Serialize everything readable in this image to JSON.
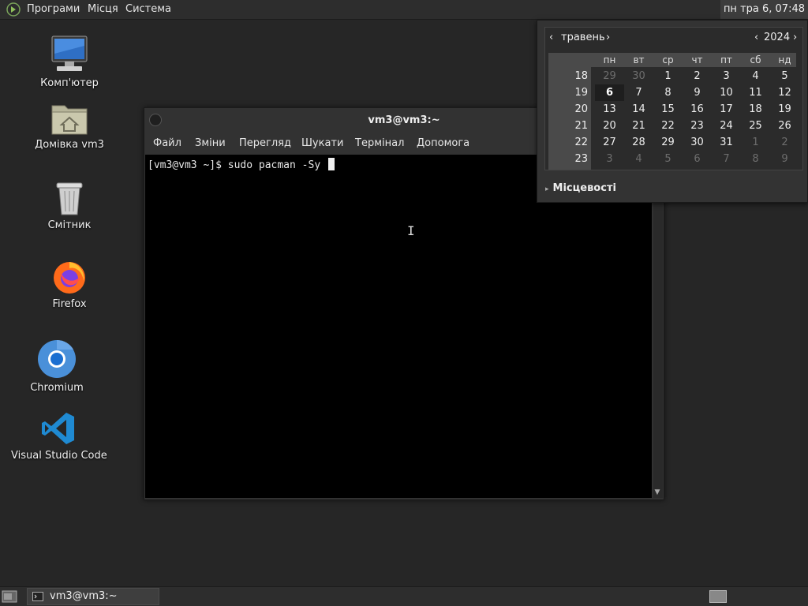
{
  "top_panel": {
    "menus": [
      "Програми",
      "Місця",
      "Система"
    ],
    "clock": "пн тра  6, 07:48"
  },
  "desktop_icons": [
    {
      "label": "Комп'ютер",
      "icon": "computer-icon"
    },
    {
      "label": "Домівка vm3",
      "icon": "home-folder-icon"
    },
    {
      "label": "Смітник",
      "icon": "trash-icon"
    },
    {
      "label": "Firefox",
      "icon": "firefox-icon"
    },
    {
      "label": "Chromium",
      "icon": "chromium-icon"
    },
    {
      "label": "Visual Studio Code",
      "icon": "vscode-icon"
    }
  ],
  "terminal": {
    "title": "vm3@vm3:~",
    "menus": [
      "Файл",
      "Зміни",
      "Перегляд",
      "Шукати",
      "Термінал",
      "Допомога"
    ],
    "command_line": "[vm3@vm3 ~]$ sudo pacman -Sy "
  },
  "calendar": {
    "month": "травень",
    "year": "2024",
    "weekdays": [
      "пн",
      "вт",
      "ср",
      "чт",
      "пт",
      "сб",
      "нд"
    ],
    "weeks": [
      "18",
      "19",
      "20",
      "21",
      "22",
      "23"
    ],
    "days": [
      [
        "29",
        "30",
        "1",
        "2",
        "3",
        "4",
        "5"
      ],
      [
        "6",
        "7",
        "8",
        "9",
        "10",
        "11",
        "12"
      ],
      [
        "13",
        "14",
        "15",
        "16",
        "17",
        "18",
        "19"
      ],
      [
        "20",
        "21",
        "22",
        "23",
        "24",
        "25",
        "26"
      ],
      [
        "27",
        "28",
        "29",
        "30",
        "31",
        "1",
        "2"
      ],
      [
        "3",
        "4",
        "5",
        "6",
        "7",
        "8",
        "9"
      ]
    ],
    "today": "6",
    "locations_label": "Місцевості"
  },
  "taskbar": {
    "window_title": "vm3@vm3:~"
  }
}
